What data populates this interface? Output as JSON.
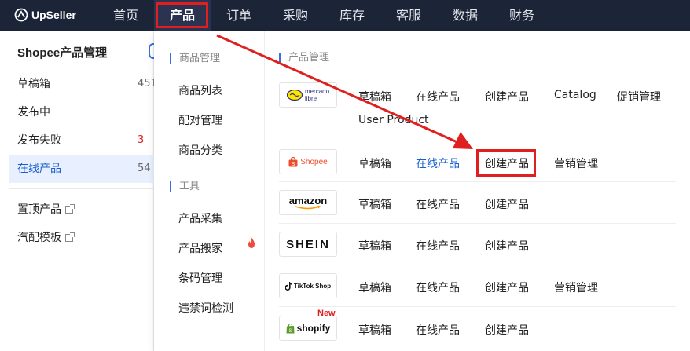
{
  "brand": {
    "name": "UpSeller"
  },
  "nav": {
    "items": [
      {
        "label": "首页"
      },
      {
        "label": "产品"
      },
      {
        "label": "订单"
      },
      {
        "label": "采购"
      },
      {
        "label": "库存"
      },
      {
        "label": "客服"
      },
      {
        "label": "数据"
      },
      {
        "label": "财务"
      }
    ]
  },
  "sidebar": {
    "title": "Shopee产品管理",
    "items": [
      {
        "label": "草稿箱",
        "count": "451"
      },
      {
        "label": "发布中",
        "count": ""
      },
      {
        "label": "发布失败",
        "count": "3"
      },
      {
        "label": "在线产品",
        "count": "54"
      }
    ],
    "links": [
      {
        "label": "置顶产品"
      },
      {
        "label": "汽配模板"
      }
    ]
  },
  "dropdown": {
    "sections": [
      {
        "title": "商品管理",
        "links": [
          "商品列表",
          "配对管理",
          "商品分类"
        ]
      },
      {
        "title": "工具",
        "links": [
          "产品采集",
          "产品搬家",
          "条码管理",
          "违禁词检测"
        ]
      }
    ],
    "right_title": "产品管理",
    "platforms": [
      {
        "logo_line1": "mercado",
        "logo_line2": "libre",
        "links": [
          "草稿箱",
          "在线产品",
          "创建产品",
          "Catalog",
          "促销管理",
          "User Product"
        ]
      },
      {
        "logo": "Shopee",
        "links": [
          "草稿箱",
          "在线产品",
          "创建产品",
          "营销管理"
        ]
      },
      {
        "logo": "amazon",
        "links": [
          "草稿箱",
          "在线产品",
          "创建产品"
        ]
      },
      {
        "logo": "SHEIN",
        "links": [
          "草稿箱",
          "在线产品",
          "创建产品"
        ]
      },
      {
        "logo": "TikTok Shop",
        "links": [
          "草稿箱",
          "在线产品",
          "创建产品",
          "营销管理"
        ]
      },
      {
        "logo": "shopify",
        "badge": "New",
        "links": [
          "草稿箱",
          "在线产品",
          "创建产品"
        ]
      }
    ]
  },
  "colors": {
    "nav_bg": "#1c2438",
    "accent": "#1a5fd0",
    "highlight": "#e02020",
    "shopee": "#ee4d2d",
    "shopify": "#5a9b2c"
  }
}
